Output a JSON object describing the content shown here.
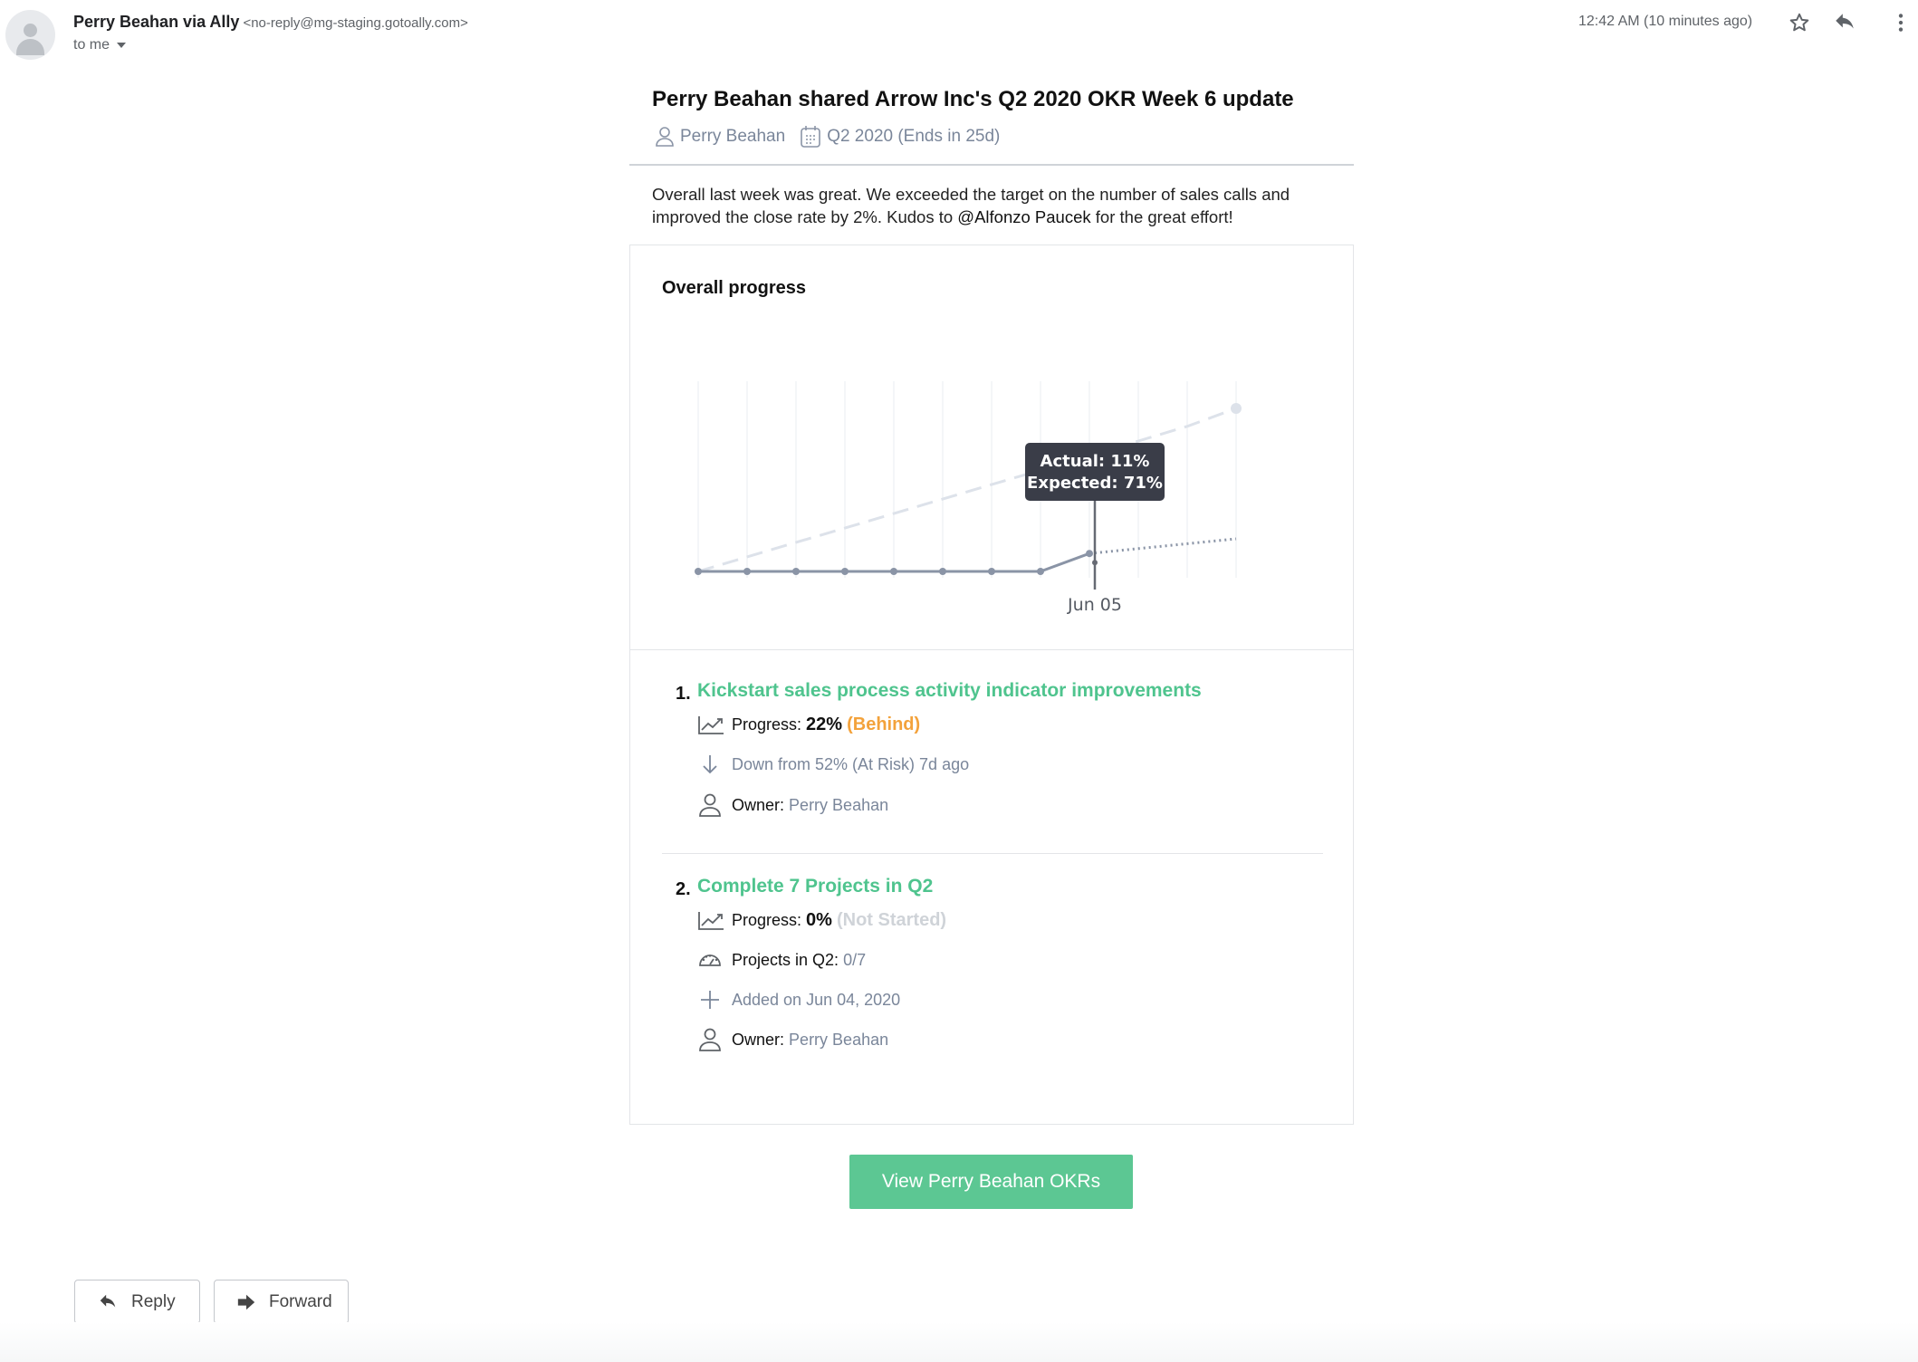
{
  "email": {
    "sender_name": "Perry Beahan via Ally",
    "sender_email": "<no-reply@mg-staging.gotoally.com>",
    "recipient": "to me",
    "timestamp": "12:42 AM (10 minutes ago)",
    "icons": [
      "star-icon",
      "reply-icon",
      "more-vert-icon"
    ]
  },
  "update": {
    "title": "Perry Beahan shared Arrow Inc's Q2 2020 OKR Week 6 update",
    "author": "Perry Beahan",
    "period": "Q2 2020 (Ends in 25d)",
    "intro_before": "Overall last week was great. We exceeded the target on the number of sales calls and improved the close rate by 2%. Kudos to ",
    "intro_mention": "@Alfonzo Paucek",
    "intro_after": " for the great effort!"
  },
  "chart_data": {
    "type": "line",
    "title": "Overall progress",
    "x_labels_shown": [
      "Jun 05"
    ],
    "highlight_index": 8,
    "tooltip": {
      "actual": "Actual: 11%",
      "expected": "Expected: 71%"
    },
    "series": [
      {
        "name": "Actual",
        "style": "solid",
        "values": [
          0,
          0,
          0,
          0,
          0,
          0,
          0,
          0,
          11
        ]
      },
      {
        "name": "Expected",
        "style": "dashed",
        "values": [
          0,
          8.9,
          17.8,
          26.6,
          35.5,
          44.4,
          53.3,
          62.1,
          71,
          80,
          89,
          100
        ]
      },
      {
        "name": "Projected",
        "style": "dotted",
        "values": [
          null,
          null,
          null,
          null,
          null,
          null,
          null,
          null,
          11,
          14,
          17,
          20
        ]
      }
    ],
    "ylim": [
      0,
      100
    ],
    "grid": true,
    "colors": {
      "actual": "#8a94a6",
      "expected": "#dde2ea",
      "tooltip_bg": "#3a3d48"
    }
  },
  "objectives": [
    {
      "number": "1.",
      "title": "Kickstart sales process activity indicator improvements",
      "progress_label": "Progress:",
      "progress_value": "22%",
      "status": "(Behind)",
      "change": "Down from 52% (At Risk) 7d ago",
      "owner_label": "Owner:",
      "owner": "Perry Beahan"
    },
    {
      "number": "2.",
      "title": "Complete 7 Projects in Q2",
      "progress_label": "Progress:",
      "progress_value": "0%",
      "status": "(Not Started)",
      "kr_label": "Projects in Q2:",
      "kr_value": "0/7",
      "added": "Added on Jun 04, 2020",
      "owner_label": "Owner:",
      "owner": "Perry Beahan"
    }
  ],
  "cta_label": "View Perry Beahan OKRs",
  "actions": {
    "reply": "Reply",
    "forward": "Forward"
  },
  "colors": {
    "accent_green": "#4fc48e",
    "button_green": "#5cc793",
    "behind_orange": "#f3a23b"
  }
}
